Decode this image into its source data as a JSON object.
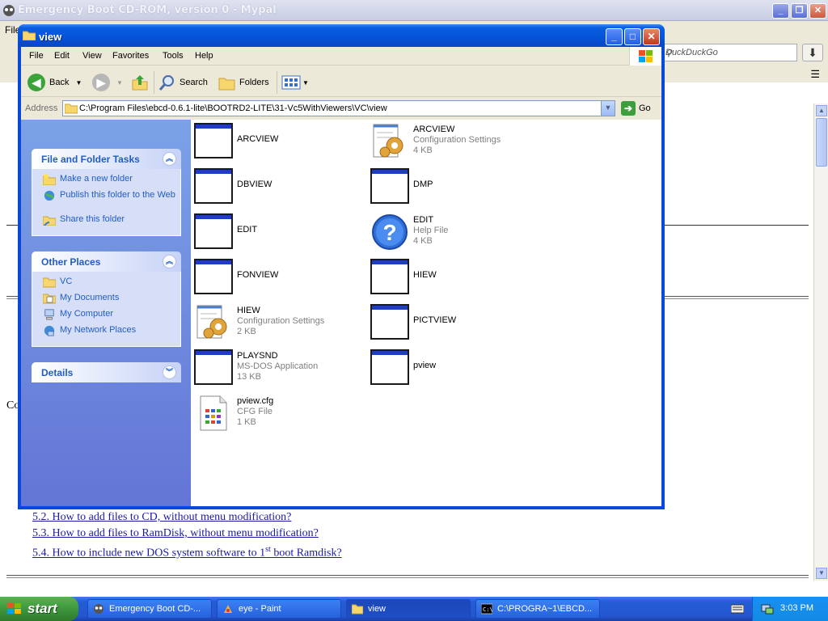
{
  "browser": {
    "title": "Emergency Boot CD-ROM, version 0 - Mypal",
    "menu_file": "File",
    "search_placeholder": "DuckDuckGo",
    "content_fragment": "Co",
    "links": [
      "5.2. How to add files to CD, without menu modification?",
      "5.3. How to add files to RamDisk, without menu modification?",
      "5.4. How to include new DOS system software to 1",
      "st",
      " boot Ramdisk?"
    ]
  },
  "explorer": {
    "title": "view",
    "menu": [
      "File",
      "Edit",
      "View",
      "Favorites",
      "Tools",
      "Help"
    ],
    "toolbar": {
      "back": "Back",
      "search": "Search",
      "folders": "Folders"
    },
    "address_label": "Address",
    "address_value": "C:\\Program Files\\ebcd-0.6.1-lite\\BOOTRD2-LITE\\31-Vc5WithViewers\\VC\\view",
    "go": "Go",
    "file_tasks": {
      "header": "File and Folder Tasks",
      "items": [
        "Make a new folder",
        "Publish this folder to the Web",
        "Share this folder"
      ]
    },
    "other_places": {
      "header": "Other Places",
      "items": [
        "VC",
        "My Documents",
        "My Computer",
        "My Network Places"
      ]
    },
    "details": {
      "header": "Details"
    },
    "files": [
      {
        "name": "ARCVIEW",
        "type": "",
        "size": "",
        "icon": "exe-icon"
      },
      {
        "name": "ARCVIEW",
        "type": "Configuration Settings",
        "size": "4 KB",
        "icon": "config-icon"
      },
      {
        "name": "DBVIEW",
        "type": "",
        "size": "",
        "icon": "exe-icon"
      },
      {
        "name": "DMP",
        "type": "",
        "size": "",
        "icon": "exe-icon"
      },
      {
        "name": "EDIT",
        "type": "",
        "size": "",
        "icon": "exe-icon"
      },
      {
        "name": "EDIT",
        "type": "Help File",
        "size": "4 KB",
        "icon": "help-icon"
      },
      {
        "name": "FONVIEW",
        "type": "",
        "size": "",
        "icon": "exe-icon"
      },
      {
        "name": "HIEW",
        "type": "",
        "size": "",
        "icon": "exe-icon"
      },
      {
        "name": "HIEW",
        "type": "Configuration Settings",
        "size": "2 KB",
        "icon": "config-icon"
      },
      {
        "name": "PICTVIEW",
        "type": "",
        "size": "",
        "icon": "exe-icon"
      },
      {
        "name": "PLAYSND",
        "type": "MS-DOS Application",
        "size": "13 KB",
        "icon": "exe-icon"
      },
      {
        "name": "pview",
        "type": "",
        "size": "",
        "icon": "exe-icon"
      },
      {
        "name": "pview.cfg",
        "type": "CFG File",
        "size": "1 KB",
        "icon": "cfg-file-icon"
      }
    ]
  },
  "taskbar": {
    "start": "start",
    "tasks": [
      {
        "label": "Emergency Boot CD-...",
        "active": false
      },
      {
        "label": "eye - Paint",
        "active": false
      },
      {
        "label": "view",
        "active": true
      },
      {
        "label": "C:\\PROGRA~1\\EBCD...",
        "active": false
      }
    ],
    "clock": "3:03 PM"
  }
}
